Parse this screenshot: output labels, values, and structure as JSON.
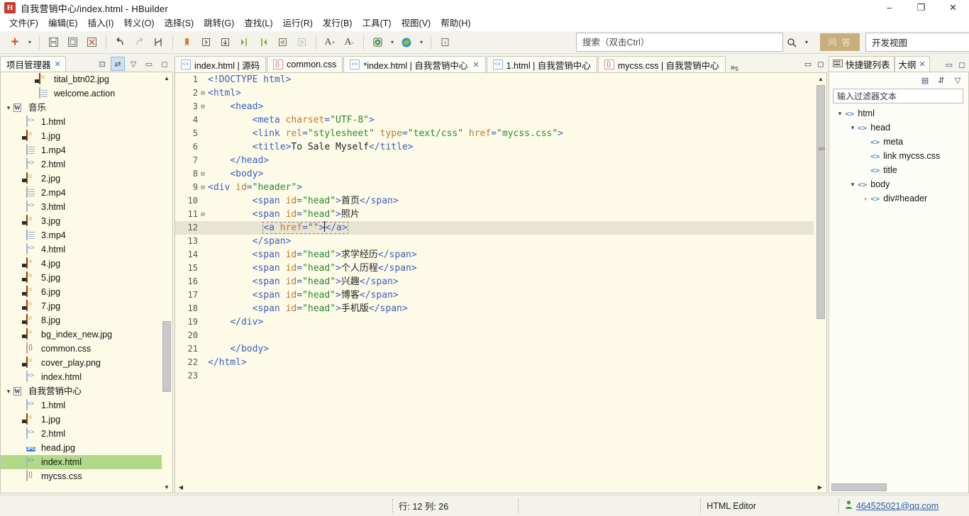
{
  "window": {
    "title": "自我营销中心/index.html  -  HBuilder",
    "app_icon": "H",
    "minimize": "−",
    "maximize": "❐",
    "close": "✕"
  },
  "menubar": {
    "items": [
      {
        "label": "文件(F)"
      },
      {
        "label": "编辑(E)"
      },
      {
        "label": "插入(I)"
      },
      {
        "label": "转义(O)"
      },
      {
        "label": "选择(S)"
      },
      {
        "label": "跳转(G)"
      },
      {
        "label": "查找(L)"
      },
      {
        "label": "运行(R)"
      },
      {
        "label": "发行(B)"
      },
      {
        "label": "工具(T)"
      },
      {
        "label": "视图(V)"
      },
      {
        "label": "帮助(H)"
      }
    ]
  },
  "toolbar": {
    "new_label": "+",
    "new_caret": "▾",
    "save_label": "💾",
    "save_all_label": "▣",
    "save_close_label": "▤",
    "undo_label": "↩",
    "redo_label": "↪",
    "compare_label": "⋈",
    "bookmark_label": "▌",
    "indent_label": "⇥",
    "outdent_label": "⇤",
    "fmt1_label": "▶|",
    "fmt2_label": "|◀",
    "wrap_label": "⏎",
    "wrap2_label": "⎙",
    "font_inc_label": "A+",
    "font_dec_label": "A-",
    "run_label": "▶",
    "run_caret": "▾",
    "browser_label": "◉",
    "browser_caret": "▾",
    "info_label": "ℹ"
  },
  "search": {
    "placeholder": "搜索（双击Ctrl）",
    "value": "",
    "magnifier": "search-icon",
    "caret": "▾",
    "ask_label": "问 答"
  },
  "view_switch": {
    "value": "开发视图",
    "caret": "⌄"
  },
  "left_panel": {
    "tab_label": "项目管理器",
    "tab_close": "✕",
    "tools": [
      {
        "name": "collapse-all-icon",
        "glyph": "⊡"
      },
      {
        "name": "link-editor-icon",
        "glyph": "⇄",
        "selected": true
      },
      {
        "name": "view-menu-icon",
        "glyph": "▽"
      },
      {
        "name": "minimize-icon",
        "glyph": "▭"
      },
      {
        "name": "maximize-icon",
        "glyph": "◻"
      }
    ],
    "tree": [
      {
        "label": "tital_btn02.jpg",
        "icon": "image",
        "indent": 3,
        "twisty": "",
        "selected": false
      },
      {
        "label": "welcome.action",
        "icon": "doc",
        "indent": 3,
        "twisty": "",
        "selected": false
      },
      {
        "label": "音乐",
        "icon": "folder",
        "indent": 1,
        "twisty": "▾",
        "selected": false
      },
      {
        "label": "1.html",
        "icon": "html",
        "indent": 2,
        "twisty": "",
        "selected": false
      },
      {
        "label": "1.jpg",
        "icon": "image",
        "indent": 2,
        "twisty": "",
        "selected": false
      },
      {
        "label": "1.mp4",
        "icon": "doc",
        "indent": 2,
        "twisty": "",
        "selected": false
      },
      {
        "label": "2.html",
        "icon": "html",
        "indent": 2,
        "twisty": "",
        "selected": false
      },
      {
        "label": "2.jpg",
        "icon": "image",
        "indent": 2,
        "twisty": "",
        "selected": false
      },
      {
        "label": "2.mp4",
        "icon": "doc",
        "indent": 2,
        "twisty": "",
        "selected": false
      },
      {
        "label": "3.html",
        "icon": "html",
        "indent": 2,
        "twisty": "",
        "selected": false
      },
      {
        "label": "3.jpg",
        "icon": "image",
        "indent": 2,
        "twisty": "",
        "selected": false
      },
      {
        "label": "3.mp4",
        "icon": "doc",
        "indent": 2,
        "twisty": "",
        "selected": false
      },
      {
        "label": "4.html",
        "icon": "html",
        "indent": 2,
        "twisty": "",
        "selected": false
      },
      {
        "label": "4.jpg",
        "icon": "image",
        "indent": 2,
        "twisty": "",
        "selected": false
      },
      {
        "label": "5.jpg",
        "icon": "image",
        "indent": 2,
        "twisty": "",
        "selected": false
      },
      {
        "label": "6.jpg",
        "icon": "image",
        "indent": 2,
        "twisty": "",
        "selected": false
      },
      {
        "label": "7.jpg",
        "icon": "image",
        "indent": 2,
        "twisty": "",
        "selected": false
      },
      {
        "label": "8.jpg",
        "icon": "image",
        "indent": 2,
        "twisty": "",
        "selected": false
      },
      {
        "label": "bg_index_new.jpg",
        "icon": "image",
        "indent": 2,
        "twisty": "",
        "selected": false
      },
      {
        "label": "common.css",
        "icon": "css",
        "indent": 2,
        "twisty": "",
        "selected": false
      },
      {
        "label": "cover_play.png",
        "icon": "image",
        "indent": 2,
        "twisty": "",
        "selected": false
      },
      {
        "label": "index.html",
        "icon": "html",
        "indent": 2,
        "twisty": "",
        "selected": false
      },
      {
        "label": "自我营销中心",
        "icon": "folder",
        "indent": 1,
        "twisty": "▾",
        "selected": false
      },
      {
        "label": "1.html",
        "icon": "html",
        "indent": 2,
        "twisty": "",
        "selected": false
      },
      {
        "label": "1.jpg",
        "icon": "image",
        "indent": 2,
        "twisty": "",
        "selected": false
      },
      {
        "label": "2.html",
        "icon": "html",
        "indent": 2,
        "twisty": "",
        "selected": false
      },
      {
        "label": "head.jpg",
        "icon": "jpg",
        "indent": 2,
        "twisty": "",
        "selected": false
      },
      {
        "label": "index.html",
        "icon": "html",
        "indent": 2,
        "twisty": "",
        "selected": true
      },
      {
        "label": "mycss.css",
        "icon": "css",
        "indent": 2,
        "twisty": "",
        "selected": false
      }
    ]
  },
  "editor": {
    "tabs": [
      {
        "label": "index.html | 源码",
        "icon": "html",
        "active": false,
        "close": ""
      },
      {
        "label": "common.css",
        "icon": "css",
        "active": false,
        "close": ""
      },
      {
        "label": "*index.html | 自我营销中心",
        "icon": "html",
        "active": true,
        "close": "✕"
      },
      {
        "label": "1.html | 自我营销中心",
        "icon": "html",
        "active": false,
        "close": ""
      },
      {
        "label": "mycss.css | 自我营销中心",
        "icon": "css",
        "active": false,
        "close": ""
      }
    ],
    "more_label": "»",
    "more_count": "5",
    "minimize": "▭",
    "maximize": "◻",
    "code_lines": [
      {
        "n": 1,
        "fold": "",
        "tokens": [
          {
            "t": "doctype",
            "v": "<!DOCTYPE html>"
          }
        ]
      },
      {
        "n": 2,
        "fold": "⊟",
        "tokens": [
          {
            "t": "tag",
            "v": "<html>"
          }
        ]
      },
      {
        "n": 3,
        "fold": "⊟",
        "tokens": [
          {
            "t": "ind",
            "v": "    "
          },
          {
            "t": "tag",
            "v": "<head>"
          }
        ]
      },
      {
        "n": 4,
        "fold": "",
        "tokens": [
          {
            "t": "ind",
            "v": "        "
          },
          {
            "t": "tag",
            "v": "<meta "
          },
          {
            "t": "attr",
            "v": "charset"
          },
          {
            "t": "punc",
            "v": "="
          },
          {
            "t": "str",
            "v": "\"UTF-8\""
          },
          {
            "t": "tag",
            "v": ">"
          }
        ]
      },
      {
        "n": 5,
        "fold": "",
        "tokens": [
          {
            "t": "ind",
            "v": "        "
          },
          {
            "t": "tag",
            "v": "<link "
          },
          {
            "t": "attr",
            "v": "rel"
          },
          {
            "t": "punc",
            "v": "="
          },
          {
            "t": "str",
            "v": "\"stylesheet\""
          },
          {
            "t": "txt",
            "v": " "
          },
          {
            "t": "attr",
            "v": "type"
          },
          {
            "t": "punc",
            "v": "="
          },
          {
            "t": "str",
            "v": "\"text/css\""
          },
          {
            "t": "txt",
            "v": " "
          },
          {
            "t": "attr",
            "v": "href"
          },
          {
            "t": "punc",
            "v": "="
          },
          {
            "t": "str",
            "v": "\"mycss.css\""
          },
          {
            "t": "tag",
            "v": ">"
          }
        ]
      },
      {
        "n": 6,
        "fold": "",
        "tokens": [
          {
            "t": "ind",
            "v": "        "
          },
          {
            "t": "tag",
            "v": "<title>"
          },
          {
            "t": "txt",
            "v": "To Sale Myself"
          },
          {
            "t": "tag",
            "v": "</title>"
          }
        ]
      },
      {
        "n": 7,
        "fold": "",
        "tokens": [
          {
            "t": "ind",
            "v": "    "
          },
          {
            "t": "tag",
            "v": "</head>"
          }
        ]
      },
      {
        "n": 8,
        "fold": "⊟",
        "tokens": [
          {
            "t": "ind",
            "v": "    "
          },
          {
            "t": "tag",
            "v": "<body>"
          }
        ]
      },
      {
        "n": 9,
        "fold": "⊟",
        "tokens": [
          {
            "t": "tag",
            "v": "<div "
          },
          {
            "t": "attr",
            "v": "id"
          },
          {
            "t": "punc",
            "v": "="
          },
          {
            "t": "str",
            "v": "\"header\""
          },
          {
            "t": "tag",
            "v": ">"
          }
        ]
      },
      {
        "n": 10,
        "fold": "",
        "tokens": [
          {
            "t": "ind",
            "v": "        "
          },
          {
            "t": "tag",
            "v": "<span "
          },
          {
            "t": "attr",
            "v": "id"
          },
          {
            "t": "punc",
            "v": "="
          },
          {
            "t": "str",
            "v": "\"head\""
          },
          {
            "t": "tag",
            "v": ">"
          },
          {
            "t": "txt",
            "v": "首页"
          },
          {
            "t": "tag",
            "v": "</span>"
          }
        ]
      },
      {
        "n": 11,
        "fold": "⊟",
        "tokens": [
          {
            "t": "ind",
            "v": "        "
          },
          {
            "t": "tag",
            "v": "<span "
          },
          {
            "t": "attr",
            "v": "id"
          },
          {
            "t": "punc",
            "v": "="
          },
          {
            "t": "str",
            "v": "\"head\""
          },
          {
            "t": "tag",
            "v": ">"
          },
          {
            "t": "txt",
            "v": "照片"
          }
        ]
      },
      {
        "n": 12,
        "fold": "",
        "highlight": true,
        "tokens": [
          {
            "t": "ind",
            "v": "          "
          },
          {
            "t": "selstart",
            "v": ""
          },
          {
            "t": "tag",
            "v": "<a "
          },
          {
            "t": "attr",
            "v": "href"
          },
          {
            "t": "punc",
            "v": "="
          },
          {
            "t": "str",
            "v": "\"\""
          },
          {
            "t": "tag",
            "v": ">"
          },
          {
            "t": "caret",
            "v": ""
          },
          {
            "t": "tag",
            "v": "</a>"
          }
        ]
      },
      {
        "n": 13,
        "fold": "",
        "tokens": [
          {
            "t": "ind",
            "v": "        "
          },
          {
            "t": "tag",
            "v": "</span>"
          }
        ]
      },
      {
        "n": 14,
        "fold": "",
        "tokens": [
          {
            "t": "ind",
            "v": "        "
          },
          {
            "t": "tag",
            "v": "<span "
          },
          {
            "t": "attr",
            "v": "id"
          },
          {
            "t": "punc",
            "v": "="
          },
          {
            "t": "str",
            "v": "\"head\""
          },
          {
            "t": "tag",
            "v": ">"
          },
          {
            "t": "txt",
            "v": "求学经历"
          },
          {
            "t": "tag",
            "v": "</span>"
          }
        ]
      },
      {
        "n": 15,
        "fold": "",
        "tokens": [
          {
            "t": "ind",
            "v": "        "
          },
          {
            "t": "tag",
            "v": "<span "
          },
          {
            "t": "attr",
            "v": "id"
          },
          {
            "t": "punc",
            "v": "="
          },
          {
            "t": "str",
            "v": "\"head\""
          },
          {
            "t": "tag",
            "v": ">"
          },
          {
            "t": "txt",
            "v": "个人历程"
          },
          {
            "t": "tag",
            "v": "</span>"
          }
        ]
      },
      {
        "n": 16,
        "fold": "",
        "tokens": [
          {
            "t": "ind",
            "v": "        "
          },
          {
            "t": "tag",
            "v": "<span "
          },
          {
            "t": "attr",
            "v": "id"
          },
          {
            "t": "punc",
            "v": "="
          },
          {
            "t": "str",
            "v": "\"head\""
          },
          {
            "t": "tag",
            "v": ">"
          },
          {
            "t": "txt",
            "v": "兴趣"
          },
          {
            "t": "tag",
            "v": "</span>"
          }
        ]
      },
      {
        "n": 17,
        "fold": "",
        "tokens": [
          {
            "t": "ind",
            "v": "        "
          },
          {
            "t": "tag",
            "v": "<span "
          },
          {
            "t": "attr",
            "v": "id"
          },
          {
            "t": "punc",
            "v": "="
          },
          {
            "t": "str",
            "v": "\"head\""
          },
          {
            "t": "tag",
            "v": ">"
          },
          {
            "t": "txt",
            "v": "博客"
          },
          {
            "t": "tag",
            "v": "</span>"
          }
        ]
      },
      {
        "n": 18,
        "fold": "",
        "tokens": [
          {
            "t": "ind",
            "v": "        "
          },
          {
            "t": "tag",
            "v": "<span "
          },
          {
            "t": "attr",
            "v": "id"
          },
          {
            "t": "punc",
            "v": "="
          },
          {
            "t": "str",
            "v": "\"head\""
          },
          {
            "t": "tag",
            "v": ">"
          },
          {
            "t": "txt",
            "v": "手机版"
          },
          {
            "t": "tag",
            "v": "</span>"
          }
        ]
      },
      {
        "n": 19,
        "fold": "",
        "tokens": [
          {
            "t": "ind",
            "v": "    "
          },
          {
            "t": "tag",
            "v": "</div>"
          }
        ]
      },
      {
        "n": 20,
        "fold": "",
        "tokens": []
      },
      {
        "n": 21,
        "fold": "",
        "tokens": [
          {
            "t": "ind",
            "v": "    "
          },
          {
            "t": "tag",
            "v": "</body>"
          }
        ]
      },
      {
        "n": 22,
        "fold": "",
        "tokens": [
          {
            "t": "tag",
            "v": "</html>"
          }
        ]
      },
      {
        "n": 23,
        "fold": "",
        "tokens": []
      }
    ]
  },
  "right_panel": {
    "tabs": [
      {
        "label": "快捷键列表",
        "active": false,
        "close": ""
      },
      {
        "label": "大纲",
        "active": true,
        "close": "✕"
      }
    ],
    "ctrls": [
      {
        "name": "minimize-icon",
        "glyph": "▭"
      },
      {
        "name": "maximize-icon",
        "glyph": "◻"
      }
    ],
    "tools": [
      {
        "name": "outline-list-icon",
        "glyph": "▤"
      },
      {
        "name": "sort-icon",
        "glyph": "⇵"
      },
      {
        "name": "view-menu-icon",
        "glyph": "▽"
      }
    ],
    "filter_placeholder": "输入过滤器文本",
    "filter_value": "",
    "outline": [
      {
        "label": "html",
        "indent": 0,
        "twisty": "▾"
      },
      {
        "label": "head",
        "indent": 1,
        "twisty": "▾"
      },
      {
        "label": "meta",
        "indent": 2,
        "twisty": ""
      },
      {
        "label": "link mycss.css",
        "indent": 2,
        "twisty": ""
      },
      {
        "label": "title",
        "indent": 2,
        "twisty": ""
      },
      {
        "label": "body",
        "indent": 1,
        "twisty": "▾"
      },
      {
        "label": "div#header",
        "indent": 2,
        "twisty": "›"
      }
    ]
  },
  "statusbar": {
    "cursor_position": "行: 12 列: 26",
    "editor_type": "HTML Editor",
    "user_email": "464525021@qq.com",
    "user_icon": "person-icon"
  }
}
